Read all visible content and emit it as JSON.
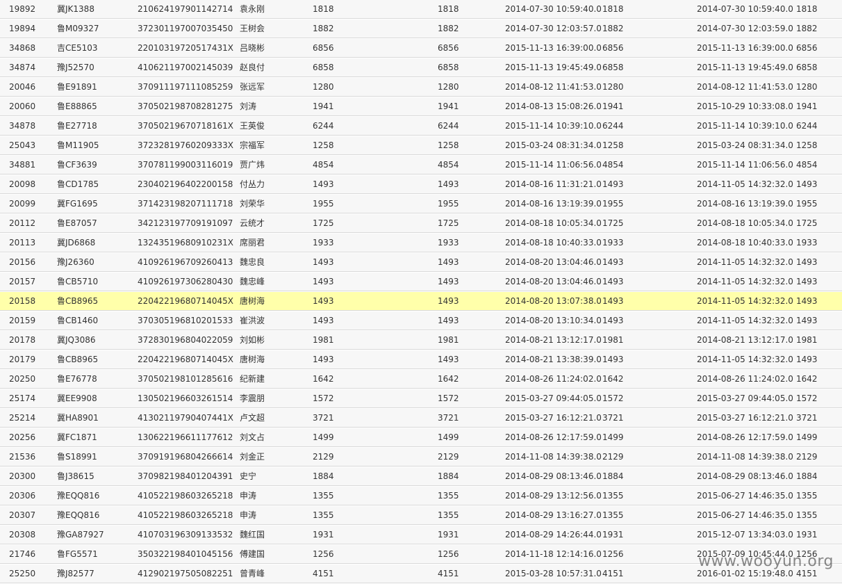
{
  "table": {
    "rows": [
      [
        "19892",
        "冀JK1388",
        "210624197901142714",
        "袁永刚",
        "1818",
        "1818",
        "2014-07-30 10:59:40.0",
        "1818",
        "2014-07-30 10:59:40.0",
        "1818"
      ],
      [
        "19894",
        "鲁M09327",
        "372301197007035450",
        "王树会",
        "1882",
        "1882",
        "2014-07-30 12:03:57.0",
        "1882",
        "2014-07-30 12:03:59.0",
        "1882"
      ],
      [
        "34868",
        "吉CE5103",
        "22010319720517431X",
        "吕晓彬",
        "6856",
        "6856",
        "2015-11-13 16:39:00.0",
        "6856",
        "2015-11-13 16:39:00.0",
        "6856"
      ],
      [
        "34874",
        "豫J52570",
        "410621197002145039",
        "赵良付",
        "6858",
        "6858",
        "2015-11-13 19:45:49.0",
        "6858",
        "2015-11-13 19:45:49.0",
        "6858"
      ],
      [
        "20046",
        "鲁E91891",
        "370911197111085259",
        "张远军",
        "1280",
        "1280",
        "2014-08-12 11:41:53.0",
        "1280",
        "2014-08-12 11:41:53.0",
        "1280"
      ],
      [
        "20060",
        "鲁E88865",
        "370502198708281275",
        "刘涛",
        "1941",
        "1941",
        "2014-08-13 15:08:26.0",
        "1941",
        "2015-10-29 10:33:08.0",
        "1941"
      ],
      [
        "34878",
        "鲁E27718",
        "37050219670718161X",
        "王英俊",
        "6244",
        "6244",
        "2015-11-14 10:39:10.0",
        "6244",
        "2015-11-14 10:39:10.0",
        "6244"
      ],
      [
        "25043",
        "鲁M11905",
        "37232819760209333X",
        "宗福军",
        "1258",
        "1258",
        "2015-03-24 08:31:34.0",
        "1258",
        "2015-03-24 08:31:34.0",
        "1258"
      ],
      [
        "34881",
        "鲁CF3639",
        "370781199003116019",
        "贾广炜",
        "4854",
        "4854",
        "2015-11-14 11:06:56.0",
        "4854",
        "2015-11-14 11:06:56.0",
        "4854"
      ],
      [
        "20098",
        "鲁CD1785",
        "230402196402200158",
        "付丛力",
        "1493",
        "1493",
        "2014-08-16 11:31:21.0",
        "1493",
        "2014-11-05 14:32:32.0",
        "1493"
      ],
      [
        "20099",
        "冀FG1695",
        "371423198207111718",
        "刘荣华",
        "1955",
        "1955",
        "2014-08-16 13:19:39.0",
        "1955",
        "2014-08-16 13:19:39.0",
        "1955"
      ],
      [
        "20112",
        "鲁E87057",
        "342123197709191097",
        "云统才",
        "1725",
        "1725",
        "2014-08-18 10:05:34.0",
        "1725",
        "2014-08-18 10:05:34.0",
        "1725"
      ],
      [
        "20113",
        "冀JD6868",
        "13243519680910231X",
        "席丽君",
        "1933",
        "1933",
        "2014-08-18 10:40:33.0",
        "1933",
        "2014-08-18 10:40:33.0",
        "1933"
      ],
      [
        "20156",
        "豫J26360",
        "410926196709260413",
        "魏忠良",
        "1493",
        "1493",
        "2014-08-20 13:04:46.0",
        "1493",
        "2014-11-05 14:32:32.0",
        "1493"
      ],
      [
        "20157",
        "鲁CB5710",
        "410926197306280430",
        "魏忠峰",
        "1493",
        "1493",
        "2014-08-20 13:04:46.0",
        "1493",
        "2014-11-05 14:32:32.0",
        "1493"
      ],
      [
        "20158",
        "鲁CB8965",
        "22042219680714045X",
        "唐树海",
        "1493",
        "1493",
        "2014-08-20 13:07:38.0",
        "1493",
        "2014-11-05 14:32:32.0",
        "1493"
      ],
      [
        "20159",
        "鲁CB1460",
        "370305196810201533",
        "崔洪波",
        "1493",
        "1493",
        "2014-08-20 13:10:34.0",
        "1493",
        "2014-11-05 14:32:32.0",
        "1493"
      ],
      [
        "20178",
        "冀JQ3086",
        "372830196804022059",
        "刘如彬",
        "1981",
        "1981",
        "2014-08-21 13:12:17.0",
        "1981",
        "2014-08-21 13:12:17.0",
        "1981"
      ],
      [
        "20179",
        "鲁CB8965",
        "22042219680714045X",
        "唐树海",
        "1493",
        "1493",
        "2014-08-21 13:38:39.0",
        "1493",
        "2014-11-05 14:32:32.0",
        "1493"
      ],
      [
        "20250",
        "鲁E76778",
        "370502198101285616",
        "纪新建",
        "1642",
        "1642",
        "2014-08-26 11:24:02.0",
        "1642",
        "2014-08-26 11:24:02.0",
        "1642"
      ],
      [
        "25174",
        "冀EE9908",
        "130502196603261514",
        "李震朋",
        "1572",
        "1572",
        "2015-03-27 09:44:05.0",
        "1572",
        "2015-03-27 09:44:05.0",
        "1572"
      ],
      [
        "25214",
        "冀HA8901",
        "41302119790407441X",
        "卢文超",
        "3721",
        "3721",
        "2015-03-27 16:12:21.0",
        "3721",
        "2015-03-27 16:12:21.0",
        "3721"
      ],
      [
        "20256",
        "冀FC1871",
        "130622196611177612",
        "刘文占",
        "1499",
        "1499",
        "2014-08-26 12:17:59.0",
        "1499",
        "2014-08-26 12:17:59.0",
        "1499"
      ],
      [
        "21536",
        "鲁S18991",
        "370919196804266614",
        "刘金正",
        "2129",
        "2129",
        "2014-11-08 14:39:38.0",
        "2129",
        "2014-11-08 14:39:38.0",
        "2129"
      ],
      [
        "20300",
        "鲁J38615",
        "370982198401204391",
        "史宁",
        "1884",
        "1884",
        "2014-08-29 08:13:46.0",
        "1884",
        "2014-08-29 08:13:46.0",
        "1884"
      ],
      [
        "20306",
        "豫EQQ816",
        "410522198603265218",
        "申涛",
        "1355",
        "1355",
        "2014-08-29 13:12:56.0",
        "1355",
        "2015-06-27 14:46:35.0",
        "1355"
      ],
      [
        "20307",
        "豫EQQ816",
        "410522198603265218",
        "申涛",
        "1355",
        "1355",
        "2014-08-29 13:16:27.0",
        "1355",
        "2015-06-27 14:46:35.0",
        "1355"
      ],
      [
        "20308",
        "豫GA87927",
        "410703196309133532",
        "魏红国",
        "1931",
        "1931",
        "2014-08-29 14:26:44.0",
        "1931",
        "2015-12-07 13:34:03.0",
        "1931"
      ],
      [
        "21746",
        "鲁FG5571",
        "350322198401045156",
        "傅建国",
        "1256",
        "1256",
        "2014-11-18 12:14:16.0",
        "1256",
        "2015-07-09 10:45:44.0",
        "1256"
      ],
      [
        "25250",
        "豫J82577",
        "412902197505082251",
        "曾青峰",
        "4151",
        "4151",
        "2015-03-28 10:57:31.0",
        "4151",
        "2016-01-02 15:19:48.0",
        "4151"
      ]
    ],
    "highlight_row": 15,
    "colors": {
      "row_bg": "#f7f7f7",
      "highlight_bg": "#ffffaa",
      "text": "#333333",
      "border": "#d9d9d9"
    }
  },
  "watermark": "www.wooyun.org"
}
